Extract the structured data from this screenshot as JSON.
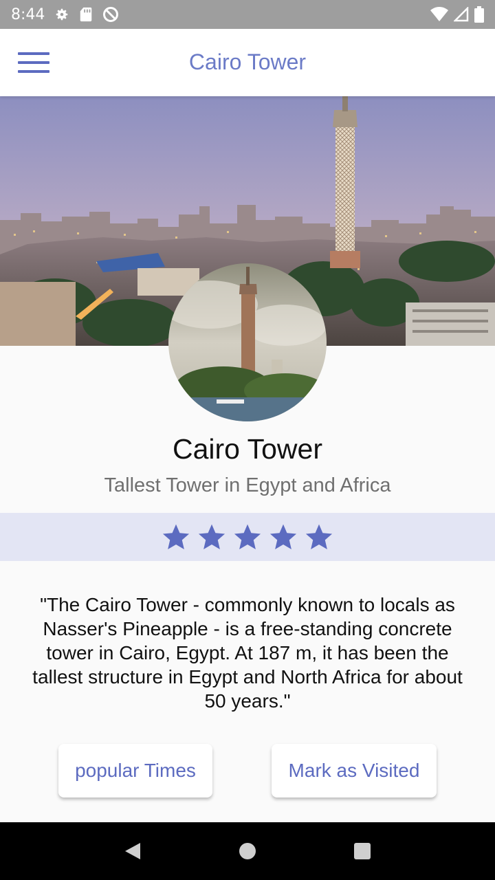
{
  "status_bar": {
    "time": "8:44",
    "left_icons": [
      "gear-icon",
      "sd-card-icon",
      "dnd-icon"
    ],
    "right_icons": [
      "wifi-icon",
      "cell-signal-icon",
      "battery-icon"
    ]
  },
  "app_bar": {
    "title": "Cairo Tower",
    "menu_icon": "hamburger-menu-icon",
    "accent_color": "#5c6bc0"
  },
  "place": {
    "title": "Cairo Tower",
    "subtitle": "Tallest Tower in Egypt and Africa",
    "rating": 5,
    "rating_max": 5,
    "description": "\"The Cairo Tower - commonly known to locals as Nasser's Pineapple - is a free-standing concrete tower in Cairo, Egypt. At 187 m, it has been the tallest structure in Egypt and North Africa for about 50 years.\""
  },
  "actions": {
    "popular_times_label": "popular Times",
    "mark_visited_label": "Mark as Visited"
  },
  "nav_bar": {
    "icons": [
      "back-icon",
      "home-icon",
      "recents-icon"
    ]
  }
}
